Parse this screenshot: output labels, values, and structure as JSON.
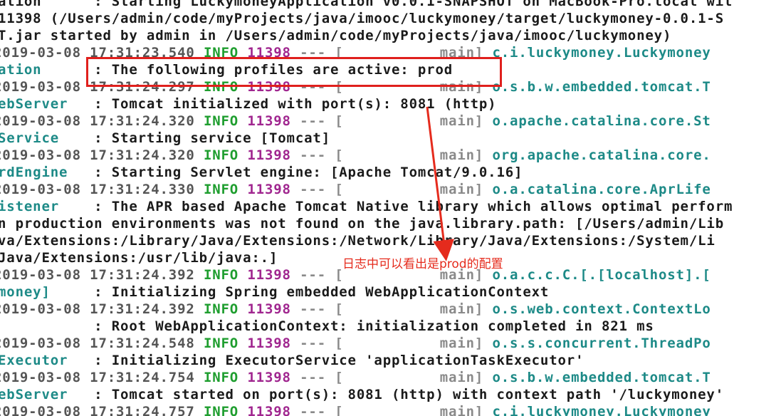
{
  "log_lines": [
    {
      "segments": [
        {
          "t": "ation      : Starting LuckymoneyApplication v0.0.1-SNAPSHOT on MacBook-Pro.local wit",
          "c": "text"
        }
      ]
    },
    {
      "segments": [
        {
          "t": "11398 (/Users/admin/code/myProjects/java/imooc/luckymoney/target/luckymoney-0.0.1-S",
          "c": "text"
        }
      ]
    },
    {
      "segments": [
        {
          "t": "T.jar started by admin in /Users/admin/code/myProjects/java/imooc/luckymoney)",
          "c": "text"
        }
      ]
    },
    {
      "segments": [
        {
          "t": "2019-03-08 17:31:23.540 ",
          "c": "date"
        },
        {
          "t": "INFO ",
          "c": "info"
        },
        {
          "t": "11398 ",
          "c": "pid"
        },
        {
          "t": "--- [           main] ",
          "c": "sep"
        },
        {
          "t": "c.i.luckymoney.Luckymoney",
          "c": "logger"
        }
      ]
    },
    {
      "segments": [
        {
          "t": "ation",
          "c": "logger"
        },
        {
          "t": "      : The following profiles are active: prod",
          "c": "text"
        }
      ]
    },
    {
      "segments": [
        {
          "t": "2019-03-08 17:31:24.297 ",
          "c": "date"
        },
        {
          "t": "INFO ",
          "c": "info"
        },
        {
          "t": "11398 ",
          "c": "pid"
        },
        {
          "t": "--- [           main] ",
          "c": "sep"
        },
        {
          "t": "o.s.b.w.embedded.tomcat.T",
          "c": "logger"
        }
      ]
    },
    {
      "segments": [
        {
          "t": "ebServer",
          "c": "logger"
        },
        {
          "t": "   : Tomcat initialized with port(s): 8081 (http)",
          "c": "text"
        }
      ]
    },
    {
      "segments": [
        {
          "t": "2019-03-08 17:31:24.320 ",
          "c": "date"
        },
        {
          "t": "INFO ",
          "c": "info"
        },
        {
          "t": "11398 ",
          "c": "pid"
        },
        {
          "t": "--- [           main] ",
          "c": "sep"
        },
        {
          "t": "o.apache.catalina.core.St",
          "c": "logger"
        }
      ]
    },
    {
      "segments": [
        {
          "t": "Service",
          "c": "logger"
        },
        {
          "t": "    : Starting service [Tomcat]",
          "c": "text"
        }
      ]
    },
    {
      "segments": [
        {
          "t": "2019-03-08 17:31:24.320 ",
          "c": "date"
        },
        {
          "t": "INFO ",
          "c": "info"
        },
        {
          "t": "11398 ",
          "c": "pid"
        },
        {
          "t": "--- [           main] ",
          "c": "sep"
        },
        {
          "t": "org.apache.catalina.core.",
          "c": "logger"
        }
      ]
    },
    {
      "segments": [
        {
          "t": "rdEngine",
          "c": "logger"
        },
        {
          "t": "   : Starting Servlet engine: [Apache Tomcat/9.0.16]",
          "c": "text"
        }
      ]
    },
    {
      "segments": [
        {
          "t": "2019-03-08 17:31:24.330 ",
          "c": "date"
        },
        {
          "t": "INFO ",
          "c": "info"
        },
        {
          "t": "11398 ",
          "c": "pid"
        },
        {
          "t": "--- [           main] ",
          "c": "sep"
        },
        {
          "t": "o.a.catalina.core.AprLife",
          "c": "logger"
        }
      ]
    },
    {
      "segments": [
        {
          "t": "istener",
          "c": "logger"
        },
        {
          "t": "    : The APR based Apache Tomcat Native library which allows optimal perform",
          "c": "text"
        }
      ]
    },
    {
      "segments": [
        {
          "t": "n production environments was not found on the java.library.path: [/Users/admin/Lib",
          "c": "text"
        }
      ]
    },
    {
      "segments": [
        {
          "t": "va/Extensions:/Library/Java/Extensions:/Network/Library/Java/Extensions:/System/Li",
          "c": "text"
        }
      ]
    },
    {
      "segments": [
        {
          "t": "Java/Extensions:/usr/lib/java:.]",
          "c": "text"
        }
      ]
    },
    {
      "segments": [
        {
          "t": "2019-03-08 17:31:24.392 ",
          "c": "date"
        },
        {
          "t": "INFO ",
          "c": "info"
        },
        {
          "t": "11398 ",
          "c": "pid"
        },
        {
          "t": "--- [           main] ",
          "c": "sep"
        },
        {
          "t": "o.a.c.c.C.[.[localhost].[",
          "c": "logger"
        }
      ]
    },
    {
      "segments": [
        {
          "t": "money]",
          "c": "logger"
        },
        {
          "t": "     : Initializing Spring embedded WebApplicationContext",
          "c": "text"
        }
      ]
    },
    {
      "segments": [
        {
          "t": "2019-03-08 17:31:24.392 ",
          "c": "date"
        },
        {
          "t": "INFO ",
          "c": "info"
        },
        {
          "t": "11398 ",
          "c": "pid"
        },
        {
          "t": "--- [           main] ",
          "c": "sep"
        },
        {
          "t": "o.s.web.context.ContextLo",
          "c": "logger"
        }
      ]
    },
    {
      "segments": [
        {
          "t": "           : Root WebApplicationContext: initialization completed in 821 ms",
          "c": "text"
        }
      ]
    },
    {
      "segments": [
        {
          "t": "2019-03-08 17:31:24.548 ",
          "c": "date"
        },
        {
          "t": "INFO ",
          "c": "info"
        },
        {
          "t": "11398 ",
          "c": "pid"
        },
        {
          "t": "--- [           main] ",
          "c": "sep"
        },
        {
          "t": "o.s.s.concurrent.ThreadPo",
          "c": "logger"
        }
      ]
    },
    {
      "segments": [
        {
          "t": "Executor",
          "c": "logger"
        },
        {
          "t": "   : Initializing ExecutorService 'applicationTaskExecutor'",
          "c": "text"
        }
      ]
    },
    {
      "segments": [
        {
          "t": "2019-03-08 17:31:24.754 ",
          "c": "date"
        },
        {
          "t": "INFO ",
          "c": "info"
        },
        {
          "t": "11398 ",
          "c": "pid"
        },
        {
          "t": "--- [           main] ",
          "c": "sep"
        },
        {
          "t": "o.s.b.w.embedded.tomcat.T",
          "c": "logger"
        }
      ]
    },
    {
      "segments": [
        {
          "t": "ebServer",
          "c": "logger"
        },
        {
          "t": "   : Tomcat started on port(s): 8081 (http) with context path '/luckymoney'",
          "c": "text"
        }
      ]
    },
    {
      "segments": [
        {
          "t": "2019-03-08 17:31:24.757 ",
          "c": "date"
        },
        {
          "t": "INFO ",
          "c": "info"
        },
        {
          "t": "11398 ",
          "c": "pid"
        },
        {
          "t": "--- [           main] ",
          "c": "sep"
        },
        {
          "t": "c.i.luckymoney.Luckymoney",
          "c": "logger"
        }
      ]
    }
  ],
  "annotation": {
    "text": "日志中可以看出是prod的配置",
    "color": "#e52b1d"
  },
  "colors": {
    "date": "#555555",
    "info": "#1f9e2f",
    "pid": "#a0268f",
    "logger": "#1d8a87",
    "text": "#1a1a1a"
  }
}
